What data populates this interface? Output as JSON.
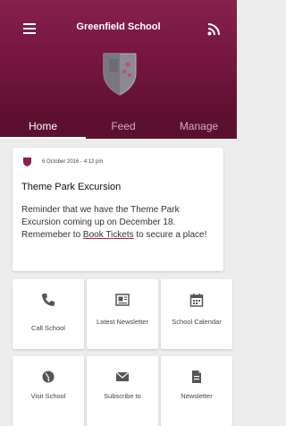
{
  "header": {
    "title": "Greenfield School",
    "menu_icon": "hamburger-menu-icon",
    "feed_icon": "rss-icon",
    "logo": "school-crest-logo",
    "brand_color": "#7a1a45"
  },
  "tabs": [
    {
      "label": "Home",
      "active": true
    },
    {
      "label": "Feed",
      "active": false
    },
    {
      "label": "Manage",
      "active": false
    }
  ],
  "post": {
    "date": "6 October 2016 - 4:12 pm",
    "title": "Theme Park Excursion",
    "body_before": "Reminder that we have the Theme Park Excursion coming up on December 18. Rememeber to",
    "link_text": "Book Tickets",
    "body_after": "to secure a place!"
  },
  "tiles": [
    {
      "label": "Call School",
      "icon": "phone-icon"
    },
    {
      "label": "Latest Newsletter",
      "icon": "newsletter-icon"
    },
    {
      "label": "School Calendar",
      "icon": "calendar-icon"
    },
    {
      "label": "Visit School",
      "icon": "globe-icon"
    },
    {
      "label": "Subscribe to",
      "icon": "mail-icon"
    },
    {
      "label": "Newsletter",
      "icon": "document-icon"
    }
  ]
}
